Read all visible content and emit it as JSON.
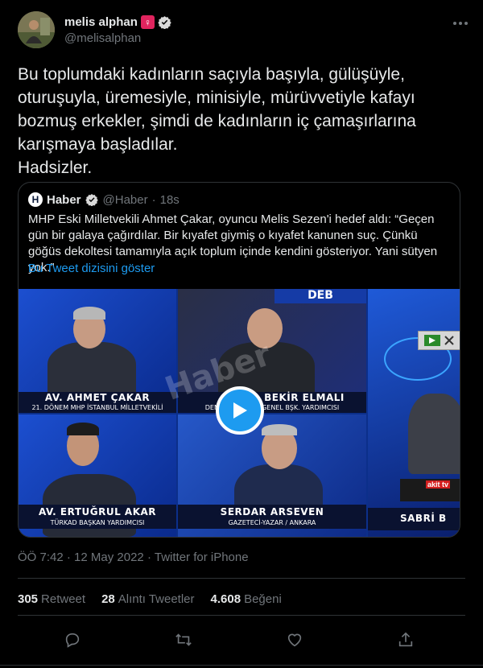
{
  "author": {
    "display_name": "melis alphan",
    "badge_glyph": "♀",
    "handle": "@melisalphan"
  },
  "tweet": {
    "text": "Bu toplumdaki kadınların saçıyla başıyla, gülüşüyle, oturuşuyla, üremesiyle, minisiyle, mürüvvetiyle kafayı bozmuş erkekler, şimdi de kadınların iç çamaşırlarına karışmaya başladılar.\nHadsizler.",
    "time": "ÖÖ 7:42",
    "date": "12 May 2022",
    "source": "Twitter for iPhone",
    "separator": "·"
  },
  "quote": {
    "logo_letter": "H",
    "name": "Haber",
    "handle": "@Haber",
    "age": "18s",
    "text": "MHP Eski Milletvekili Ahmet Çakar, oyuncu Melis Sezen'i hedef aldı: “Geçen gün bir galaya çağırdılar. Bir kıyafet giymiş o kıyafet kanunen suç. Çünkü göğüs dekoltesi tamamıyla açık toplum içinde kendini gösteriyor. Yani sütyen yok.”",
    "thread_link": "Bu Tweet dizisini göster"
  },
  "video": {
    "banner": "DEB",
    "watermark": "Haber",
    "panels": [
      {
        "name": "AV. AHMET ÇAKAR",
        "sub": "21. DÖNEM MHP İSTANBUL MİLLETVEKİLİ"
      },
      {
        "name": "BEKİR ELMALI",
        "sub": "DEMOK…    …NEĞİ GENEL BŞK. YARDIMCISI"
      },
      {
        "name": "AV. ERTUĞRUL AKAR",
        "sub": "TÜRKAD BAŞKAN YARDIMCISI"
      },
      {
        "name": "SERDAR ARSEVEN",
        "sub": "GAZETECİ-YAZAR / ANKARA"
      },
      {
        "name": "SABRİ B",
        "sub": ""
      }
    ],
    "channel_logo": "akit tv"
  },
  "stats": {
    "retweets": {
      "count": "305",
      "label": "Retweet"
    },
    "quotes": {
      "count": "28",
      "label": "Alıntı Tweetler"
    },
    "likes": {
      "count": "4.608",
      "label": "Beğeni"
    }
  },
  "colors": {
    "accent": "#1d9bf0",
    "background": "#000000",
    "text": "#e7e9ea",
    "muted": "#71767b",
    "border": "#2f3336"
  },
  "icons": [
    "more-icon",
    "verified-icon",
    "play-icon",
    "reply-icon",
    "retweet-icon",
    "like-icon",
    "share-icon"
  ]
}
